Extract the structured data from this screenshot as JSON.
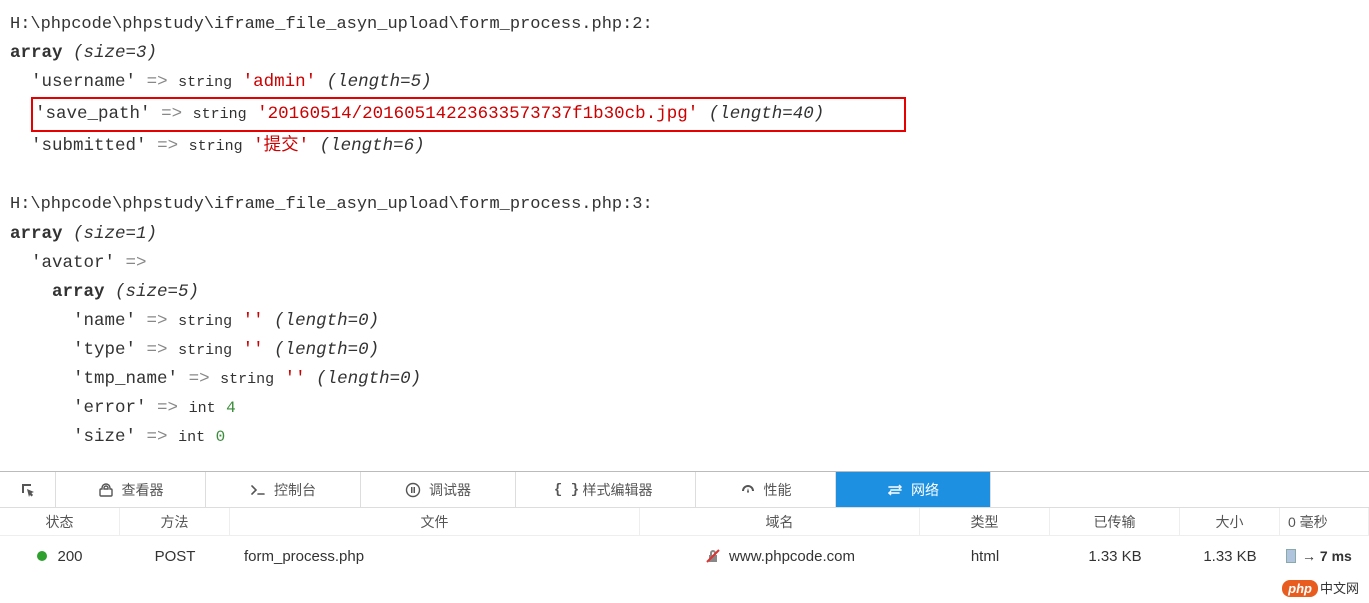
{
  "dump1": {
    "path": "H:\\phpcode\\phpstudy\\iframe_file_asyn_upload\\form_process.php:2:",
    "size": "(size=3)",
    "rows": {
      "username": {
        "key": "'username'",
        "type": "string",
        "value": "'admin'",
        "len": "(length=5)"
      },
      "save_path": {
        "key": "'save_path'",
        "type": "string",
        "value": "'20160514/20160514223633573737f1b30cb.jpg'",
        "len": "(length=40)"
      },
      "submitted": {
        "key": "'submitted'",
        "type": "string",
        "value": "'提交'",
        "len": "(length=6)"
      }
    }
  },
  "dump2": {
    "path": "H:\\phpcode\\phpstudy\\iframe_file_asyn_upload\\form_process.php:3:",
    "size": "(size=1)",
    "avator_key": "'avator'",
    "inner_size": "(size=5)",
    "rows": {
      "name": {
        "key": "'name'",
        "type": "string",
        "value": "''",
        "len": "(length=0)"
      },
      "type": {
        "key": "'type'",
        "type": "string",
        "value": "''",
        "len": "(length=0)"
      },
      "tmp_name": {
        "key": "'tmp_name'",
        "type": "string",
        "value": "''",
        "len": "(length=0)"
      },
      "error": {
        "key": "'error'",
        "type": "int",
        "value": "4"
      },
      "size": {
        "key": "'size'",
        "type": "int",
        "value": "0"
      }
    }
  },
  "devtools": {
    "tabs": {
      "pick": "",
      "inspector": "查看器",
      "console": "控制台",
      "debugger": "调试器",
      "styleeditor": "样式编辑器",
      "performance": "性能",
      "network": "网络"
    },
    "headers": {
      "state": "状态",
      "method": "方法",
      "file": "文件",
      "domain": "域名",
      "type": "类型",
      "transferred": "已传输",
      "size": "大小",
      "time": "0 毫秒"
    },
    "row": {
      "status": "200",
      "method": "POST",
      "file": "form_process.php",
      "domain": "www.phpcode.com",
      "type": "html",
      "transferred": "1.33 KB",
      "size": "1.33 KB",
      "time": "→ 7 ms"
    }
  },
  "watermark": {
    "php": "php",
    "cn": "中文网"
  }
}
